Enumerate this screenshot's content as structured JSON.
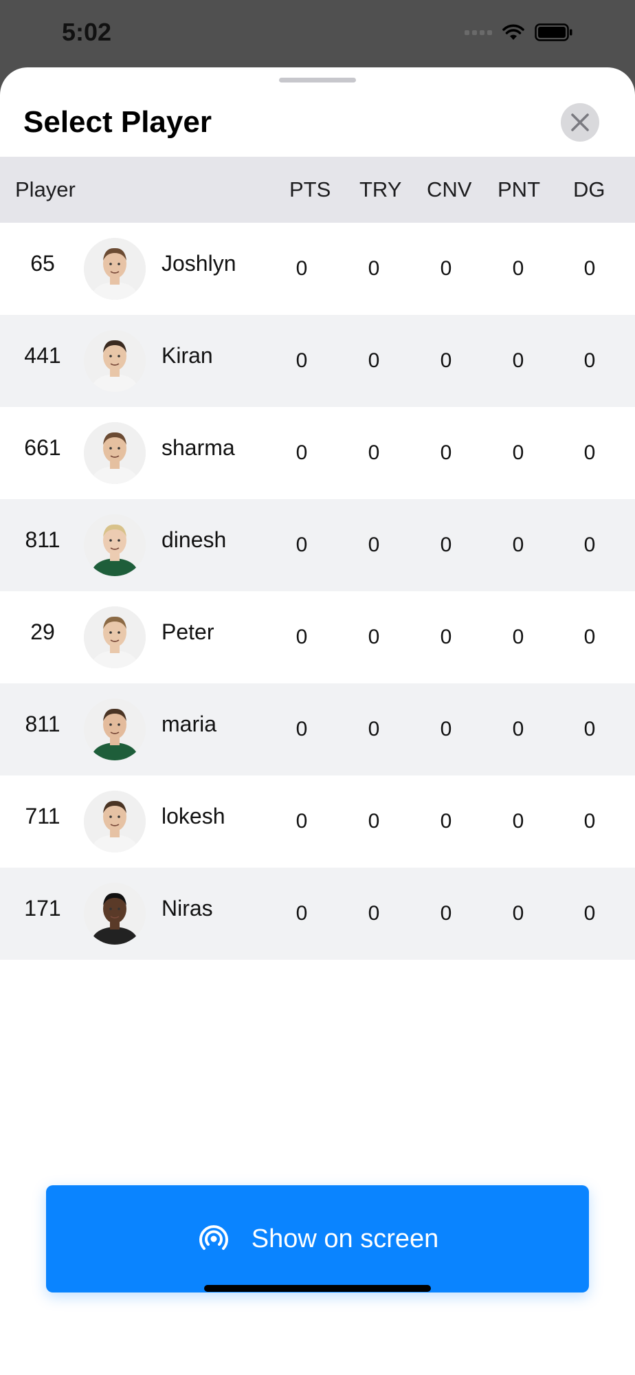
{
  "status_bar": {
    "time": "5:02"
  },
  "sheet": {
    "title": "Select Player"
  },
  "table": {
    "columns": [
      "Player",
      "PTS",
      "TRY",
      "CNV",
      "PNT",
      "DG"
    ],
    "rows": [
      {
        "number": "65",
        "name": "Joshlyn",
        "pts": "0",
        "try": "0",
        "cnv": "0",
        "pnt": "0",
        "dg": "0"
      },
      {
        "number": "441",
        "name": "Kiran",
        "pts": "0",
        "try": "0",
        "cnv": "0",
        "pnt": "0",
        "dg": "0"
      },
      {
        "number": "661",
        "name": "sharma",
        "pts": "0",
        "try": "0",
        "cnv": "0",
        "pnt": "0",
        "dg": "0"
      },
      {
        "number": "811",
        "name": "dinesh",
        "pts": "0",
        "try": "0",
        "cnv": "0",
        "pnt": "0",
        "dg": "0"
      },
      {
        "number": "29",
        "name": "Peter",
        "pts": "0",
        "try": "0",
        "cnv": "0",
        "pnt": "0",
        "dg": "0"
      },
      {
        "number": "811",
        "name": "maria",
        "pts": "0",
        "try": "0",
        "cnv": "0",
        "pnt": "0",
        "dg": "0"
      },
      {
        "number": "711",
        "name": "lokesh",
        "pts": "0",
        "try": "0",
        "cnv": "0",
        "pnt": "0",
        "dg": "0"
      },
      {
        "number": "171",
        "name": "Niras",
        "pts": "0",
        "try": "0",
        "cnv": "0",
        "pnt": "0",
        "dg": "0"
      }
    ]
  },
  "action": {
    "show_label": "Show on screen",
    "icon": "airplay-broadcast-icon"
  },
  "colors": {
    "accent": "#0a84ff",
    "header_bg": "#e5e5ea",
    "alt_row_bg": "#f1f2f4"
  }
}
